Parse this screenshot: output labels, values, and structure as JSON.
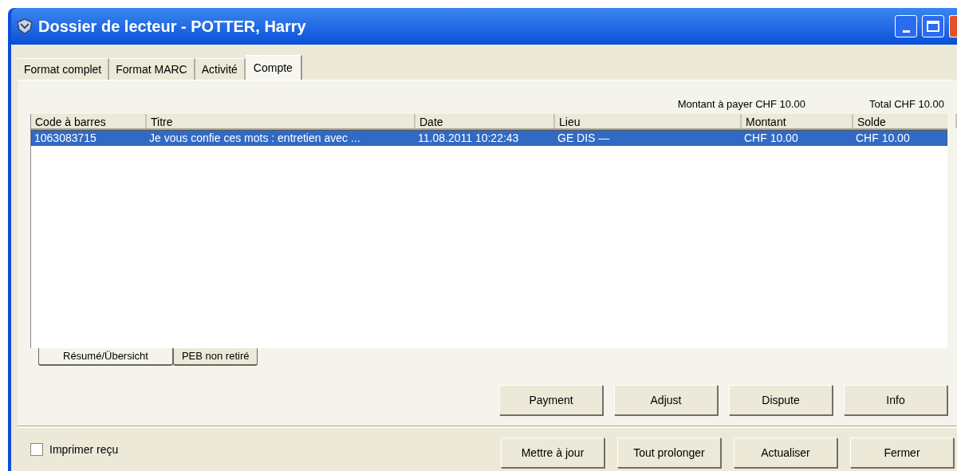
{
  "window": {
    "title": "Dossier de lecteur - POTTER, Harry"
  },
  "tabs": [
    {
      "label": "Format complet",
      "selected": false
    },
    {
      "label": "Format MARC",
      "selected": false
    },
    {
      "label": "Activité",
      "selected": false
    },
    {
      "label": "Compte",
      "selected": true
    }
  ],
  "summary": {
    "amount_due": "Montant à payer CHF 10.00",
    "total": "Total CHF 10.00"
  },
  "table": {
    "columns": [
      "Code à barres",
      "Titre",
      "Date",
      "Lieu",
      "Montant",
      "Solde"
    ],
    "rows": [
      {
        "cells": [
          "1063083715",
          "Je vous confie ces mots : entretien avec ...",
          "11.08.2011 10:22:43",
          "GE DIS —",
          "CHF 10.00",
          "CHF 10.00"
        ],
        "selected": true
      }
    ]
  },
  "sheet_tabs": [
    {
      "label": "Résumé/Übersicht",
      "selected": true
    },
    {
      "label": "PEB non retiré",
      "selected": false
    }
  ],
  "action_buttons": [
    "Payment",
    "Adjust",
    "Dispute",
    "Info"
  ],
  "print_receipt": {
    "label": "Imprimer reçu",
    "checked": false
  },
  "footer_buttons": [
    "Mettre à jour",
    "Tout prolonger",
    "Actualiser",
    "Fermer"
  ]
}
